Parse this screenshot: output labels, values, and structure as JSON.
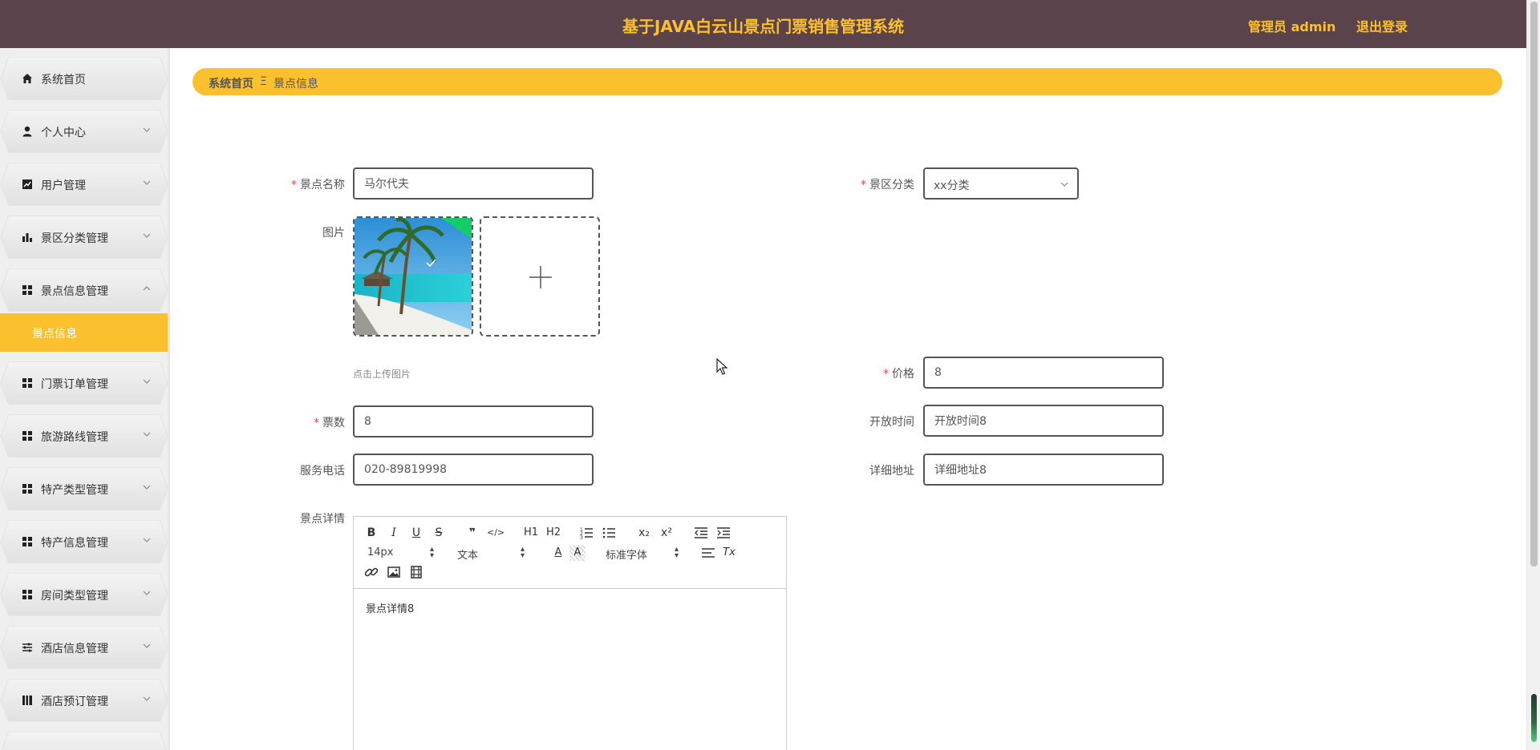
{
  "header": {
    "title": "基于JAVA白云山景点门票销售管理系统",
    "admin": "管理员 admin",
    "logout": "退出登录"
  },
  "sidebar": {
    "items": [
      {
        "label": "系统首页",
        "icon": "home-icon"
      },
      {
        "label": "个人中心",
        "icon": "user-icon"
      },
      {
        "label": "用户管理",
        "icon": "chart-line-icon"
      },
      {
        "label": "景区分类管理",
        "icon": "bar-chart-icon"
      },
      {
        "label": "景点信息管理",
        "icon": "grid-icon"
      },
      {
        "label": "门票订单管理",
        "icon": "grid-icon"
      },
      {
        "label": "旅游路线管理",
        "icon": "grid-icon"
      },
      {
        "label": "特产类型管理",
        "icon": "grid-icon"
      },
      {
        "label": "特产信息管理",
        "icon": "grid-icon"
      },
      {
        "label": "房间类型管理",
        "icon": "grid-icon"
      },
      {
        "label": "酒店信息管理",
        "icon": "sliders-icon"
      },
      {
        "label": "酒店预订管理",
        "icon": "book-icon"
      }
    ],
    "active_sub": "景点信息"
  },
  "breadcrumb": {
    "home": "系统首页",
    "separator": "Ξ",
    "current": "景点信息"
  },
  "form": {
    "name_label": "景点名称",
    "name_value": "马尔代夫",
    "category_label": "景区分类",
    "category_value": "xx分类",
    "image_label": "图片",
    "upload_tip": "点击上传图片",
    "price_label": "价格",
    "price_value": "8",
    "tickets_label": "票数",
    "tickets_value": "8",
    "open_time_label": "开放时间",
    "open_time_value": "开放时间8",
    "phone_label": "服务电话",
    "phone_value": "020-89819998",
    "address_label": "详细地址",
    "address_value": "详细地址8",
    "detail_label": "景点详情",
    "required_mark": "*"
  },
  "editor": {
    "font_size": "14px",
    "heading": "文本",
    "font_family": "标准字体",
    "content": "景点详情8",
    "buttons": {
      "bold": "B",
      "italic": "I",
      "underline": "U",
      "strike": "S",
      "quote": "❞",
      "code": "</>",
      "h1": "H1",
      "h2": "H2",
      "sub": "x₂",
      "sup": "x²",
      "color": "A",
      "background": "A",
      "clear": "Tx"
    }
  },
  "colors": {
    "header_bg": "#5b434b",
    "accent": "#fbc02d",
    "required": "#e64a4a"
  }
}
